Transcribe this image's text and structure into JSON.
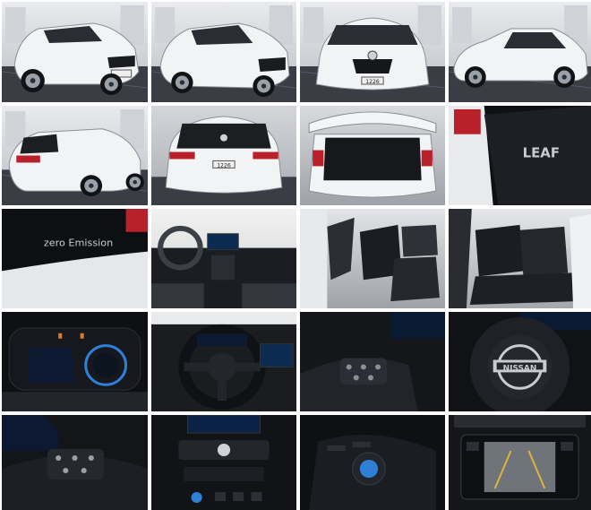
{
  "gallery": {
    "photos": [
      {
        "name": "front-left-three-quarter-photo",
        "kind": "ext-front3q"
      },
      {
        "name": "front-left-angle-photo",
        "kind": "ext-front3q2"
      },
      {
        "name": "front-view-photo",
        "kind": "ext-front"
      },
      {
        "name": "side-profile-photo",
        "kind": "ext-side"
      },
      {
        "name": "rear-left-three-quarter-photo",
        "kind": "ext-rear3q"
      },
      {
        "name": "rear-view-photo",
        "kind": "ext-rear"
      },
      {
        "name": "open-hatch-cargo-photo",
        "kind": "ext-cargo"
      },
      {
        "name": "leaf-badge-closeup-photo",
        "kind": "badge-leaf"
      },
      {
        "name": "zero-emission-badge-photo",
        "kind": "badge-zero"
      },
      {
        "name": "dashboard-interior-photo",
        "kind": "int-dash"
      },
      {
        "name": "front-seats-photo",
        "kind": "int-seats"
      },
      {
        "name": "rear-seats-photo",
        "kind": "int-rear"
      },
      {
        "name": "instrument-cluster-photo",
        "kind": "int-cluster"
      },
      {
        "name": "steering-wheel-photo",
        "kind": "int-wheel"
      },
      {
        "name": "wheel-controls-left-photo",
        "kind": "int-wheelctl"
      },
      {
        "name": "steering-hub-logo-photo",
        "kind": "int-hub"
      },
      {
        "name": "wheel-buttons-closeup-photo",
        "kind": "int-btns"
      },
      {
        "name": "center-console-photo",
        "kind": "int-console"
      },
      {
        "name": "shifter-knob-photo",
        "kind": "int-shifter"
      },
      {
        "name": "backup-camera-screen-photo",
        "kind": "int-camera"
      }
    ],
    "plates": {
      "front": "1226",
      "rear": "1226"
    },
    "badges": {
      "model": "LEAF",
      "emission": "zero Emission",
      "brand": "NISSAN"
    },
    "colors": {
      "car_white": "#f2f3f5",
      "interior_black": "#1b1d22",
      "showroom_floor": "#3a3d44",
      "taillight_red": "#b8202a",
      "accent_blue": "#2f7fd6"
    }
  }
}
